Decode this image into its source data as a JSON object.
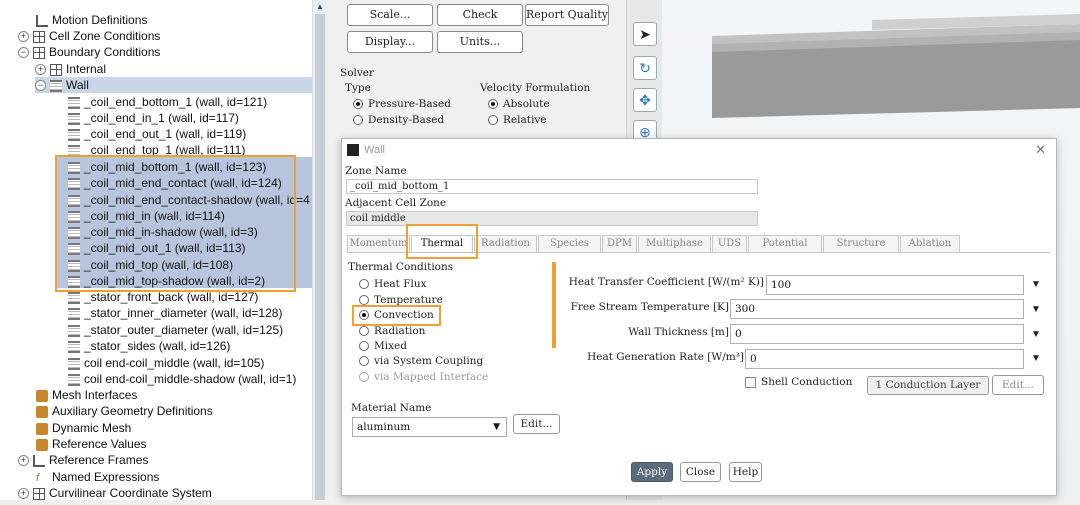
{
  "tree": {
    "items": [
      {
        "label": "Motion Definitions"
      },
      {
        "label": "Cell Zone Conditions"
      },
      {
        "label": "Boundary Conditions"
      },
      {
        "label": "Internal"
      },
      {
        "label": "Wall"
      },
      {
        "label": "_coil_end_bottom_1 (wall, id=121)"
      },
      {
        "label": "_coil_end_in_1 (wall, id=117)"
      },
      {
        "label": "_coil_end_out_1 (wall, id=119)"
      },
      {
        "label": "_coil_end_top_1 (wall, id=111)"
      },
      {
        "label": "_coil_mid_bottom_1 (wall, id=123)"
      },
      {
        "label": "_coil_mid_end_contact (wall, id=124)"
      },
      {
        "label": "_coil_mid_end_contact-shadow (wall, id=4"
      },
      {
        "label": "_coil_mid_in (wall, id=114)"
      },
      {
        "label": "_coil_mid_in-shadow (wall, id=3)"
      },
      {
        "label": "_coil_mid_out_1 (wall, id=113)"
      },
      {
        "label": "_coil_mid_top (wall, id=108)"
      },
      {
        "label": "_coil_mid_top-shadow (wall, id=2)"
      },
      {
        "label": "_stator_front_back (wall, id=127)"
      },
      {
        "label": "_stator_inner_diameter (wall, id=128)"
      },
      {
        "label": "_stator_outer_diameter (wall, id=125)"
      },
      {
        "label": "_stator_sides (wall, id=126)"
      },
      {
        "label": "coil end-coil_middle (wall, id=105)"
      },
      {
        "label": "coil end-coil_middle-shadow (wall, id=1)"
      },
      {
        "label": "Mesh Interfaces"
      },
      {
        "label": "Auxiliary Geometry Definitions"
      },
      {
        "label": "Dynamic Mesh"
      },
      {
        "label": "Reference Values"
      },
      {
        "label": "Reference Frames"
      },
      {
        "label": "Named Expressions"
      },
      {
        "label": "Curvilinear Coordinate System"
      }
    ]
  },
  "general": {
    "scale_btn": "Scale...",
    "check_btn": "Check",
    "report_quality_btn": "Report Quality",
    "display_btn": "Display...",
    "units_btn": "Units...",
    "solver_label": "Solver",
    "type_label": "Type",
    "type_options": [
      "Pressure-Based",
      "Density-Based"
    ],
    "velocity_label": "Velocity Formulation",
    "velocity_options": [
      "Absolute",
      "Relative"
    ]
  },
  "dialog": {
    "title": "Wall",
    "zone_name_label": "Zone Name",
    "zone_name_value": "_coil_mid_bottom_1",
    "adjacent_label": "Adjacent Cell Zone",
    "adjacent_value": "coil middle",
    "tabs": [
      "Momentum",
      "Thermal",
      "Radiation",
      "Species",
      "DPM",
      "Multiphase",
      "UDS",
      "Potential",
      "Structure",
      "Ablation"
    ],
    "thermal_conditions_label": "Thermal Conditions",
    "thermal_options": [
      "Heat Flux",
      "Temperature",
      "Convection",
      "Radiation",
      "Mixed",
      "via System Coupling",
      "via Mapped Interface"
    ],
    "htc_label": "Heat Transfer Coefficient [W/(m² K)]",
    "htc_value": "100",
    "fst_label": "Free Stream Temperature [K]",
    "fst_value": "300",
    "wt_label": "Wall Thickness [m]",
    "wt_value": "0",
    "hgr_label": "Heat Generation Rate [W/m³]",
    "hgr_value": "0",
    "shell_conduction_label": "Shell Conduction",
    "conduction_layer_btn": "1 Conduction Layer",
    "edit_btn": "Edit...",
    "material_name_label": "Material Name",
    "material_value": "aluminum",
    "apply_btn": "Apply",
    "close_btn": "Close",
    "help_btn": "Help"
  },
  "colors": {
    "highlight": "#f0a030",
    "selection": "#b7c6dc",
    "apply": "#5b6c7d"
  }
}
